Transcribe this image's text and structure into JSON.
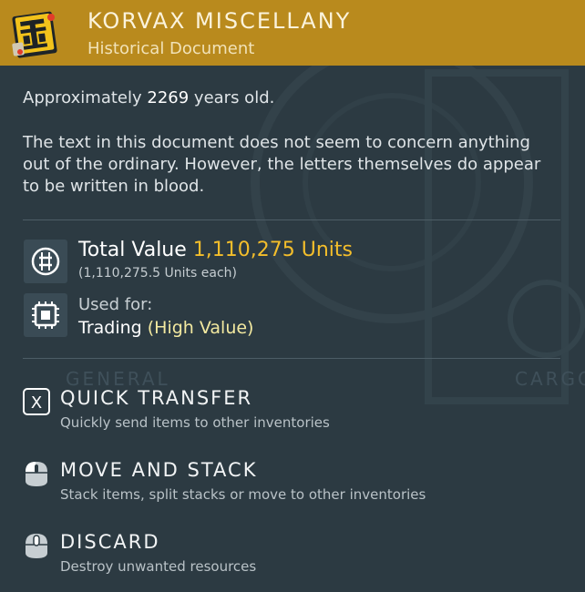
{
  "item": {
    "name": "KORVAX MISCELLANY",
    "category": "Historical Document",
    "age_prefix": "Approximately",
    "age_value": "2269",
    "age_suffix": "years old.",
    "description": "The text in this document does not seem to concern anything out of the ordinary. However, the letters themselves do appear to be written in blood.",
    "icon": "korvax-document-icon"
  },
  "value": {
    "label": "Total Value",
    "amount": "1,110,275 Units",
    "each": "(1,110,275.5 Units each)",
    "icon": "units-icon"
  },
  "usage": {
    "label": "Used for:",
    "value": "Trading",
    "qualifier": "(High Value)",
    "icon": "trade-chip-icon"
  },
  "background_labels": {
    "general": "GENERAL",
    "cargo": "CARGO"
  },
  "actions": [
    {
      "label": "QUICK TRANSFER",
      "description": "Quickly send items to other inventories",
      "icon": "x-key-icon",
      "key": "X"
    },
    {
      "label": "MOVE AND STACK",
      "description": "Stack items, split stacks or move to other inventories",
      "icon": "mouse-left-click-icon"
    },
    {
      "label": "DISCARD",
      "description": "Destroy unwanted resources",
      "icon": "mouse-middle-click-icon"
    }
  ],
  "colors": {
    "header": "#b98a1d",
    "panel": "#2c3a42",
    "value_accent": "#f4be2b",
    "high_value": "#f3e9a0"
  }
}
